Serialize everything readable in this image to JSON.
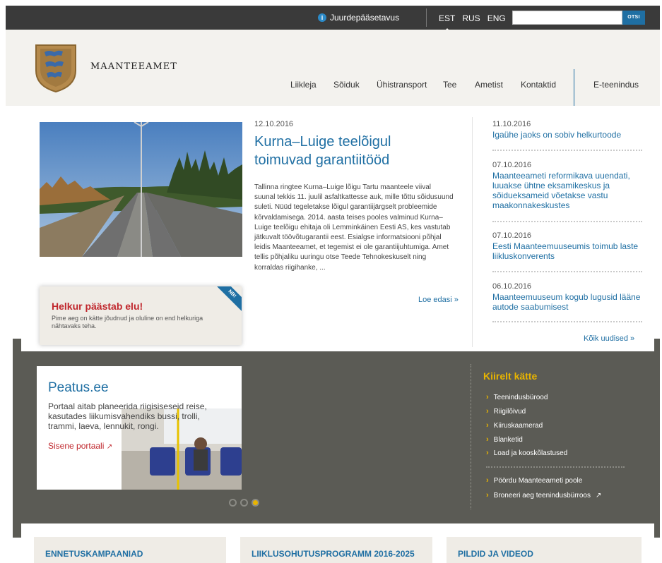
{
  "topbar": {
    "accessibility_label": "Juurdepääsetavus",
    "accessibility_icon": "accessibility-icon",
    "languages": [
      "EST",
      "RUS",
      "ENG"
    ],
    "active_language": "EST",
    "search_placeholder": "",
    "search_button": "OTSI"
  },
  "header": {
    "brand": "MAANTEEAMET",
    "logo_icon": "coat-of-arms-logo",
    "nav": [
      "Liikleja",
      "Sõiduk",
      "Ühistransport",
      "Tee",
      "Ametist",
      "Kontaktid",
      "E-teenindus"
    ]
  },
  "main_news": {
    "date": "12.10.2016",
    "title": "Kurna–Luige teelõigul toimuvad garantiitööd",
    "body": "Tallinna ringtee Kurna–Luige lõigu Tartu maanteele viival suunal tekkis 11. juulil asfaltkattesse auk, mille tõttu sõidusuund suleti. Nüüd tegeletakse lõigul garantiijärgselt probleemide kõrvaldamisega. 2014. aasta teises pooles valminud Kurna–Luige teelõigu ehitaja oli Lemminkäinen Eesti AS, kes vastutab jätkuvalt töövõtugarantii eest. Esialgse informatsiooni põhjal leidis Maanteeamet, et tegemist ei ole garantiijuhtumiga. Amet tellis põhjaliku uuringu otse Teede Tehnokeskuselt ning korraldas riigihanke, ...",
    "read_more": "Loe edasi »"
  },
  "promo": {
    "title": "Helkur päästab elu!",
    "text": "Pime aeg on kätte jõudnud ja oluline on end helkuriga nähtavaks teha.",
    "ribbon": "NB!"
  },
  "side_news": [
    {
      "date": "11.10.2016",
      "title": "Igaühe jaoks on sobiv helkurtoode"
    },
    {
      "date": "07.10.2016",
      "title": "Maanteeameti reformikava uuendati, luuakse ühtne eksamikeskus ja sõidueksameid võetakse vastu maakonnakeskustes"
    },
    {
      "date": "07.10.2016",
      "title": "Eesti Maanteemuuseumis toimub laste liikluskonverents"
    },
    {
      "date": "06.10.2016",
      "title": "Maanteemuuseum kogub lugusid lääne autode saabumisest"
    }
  ],
  "all_news": "Kõik uudised »",
  "slider": {
    "title": "Peatus.ee",
    "text": "Portaal aitab planeerida riigisiseseid reise, kasutades liikumisvahendiks bussi, trolli, trammi, laeva, lennukit, rongi.",
    "link": "Sisene portaali",
    "active_dot": 3,
    "dot_count": 3
  },
  "quick": {
    "title": "Kiirelt kätte",
    "links": [
      "Teenindusbürood",
      "Riigilõivud",
      "Kiiruskaamerad",
      "Blanketid",
      "Load ja kooskõlastused"
    ],
    "links2": [
      "Pöördu Maanteeameti poole",
      "Broneeri aeg teenindusbürroos"
    ]
  },
  "bottom_tiles": [
    "ENNETUSKAMPAANIAD",
    "LIIKLUSOHUTUSPROGRAMM 2016-2025",
    "PILDID JA VIDEOD"
  ],
  "colors": {
    "brand_blue": "#1f6fa3",
    "accent_yellow": "#e8b400",
    "promo_red": "#c0272d",
    "dark_band": "#5b5b55",
    "topbar": "#3a3a3a"
  }
}
